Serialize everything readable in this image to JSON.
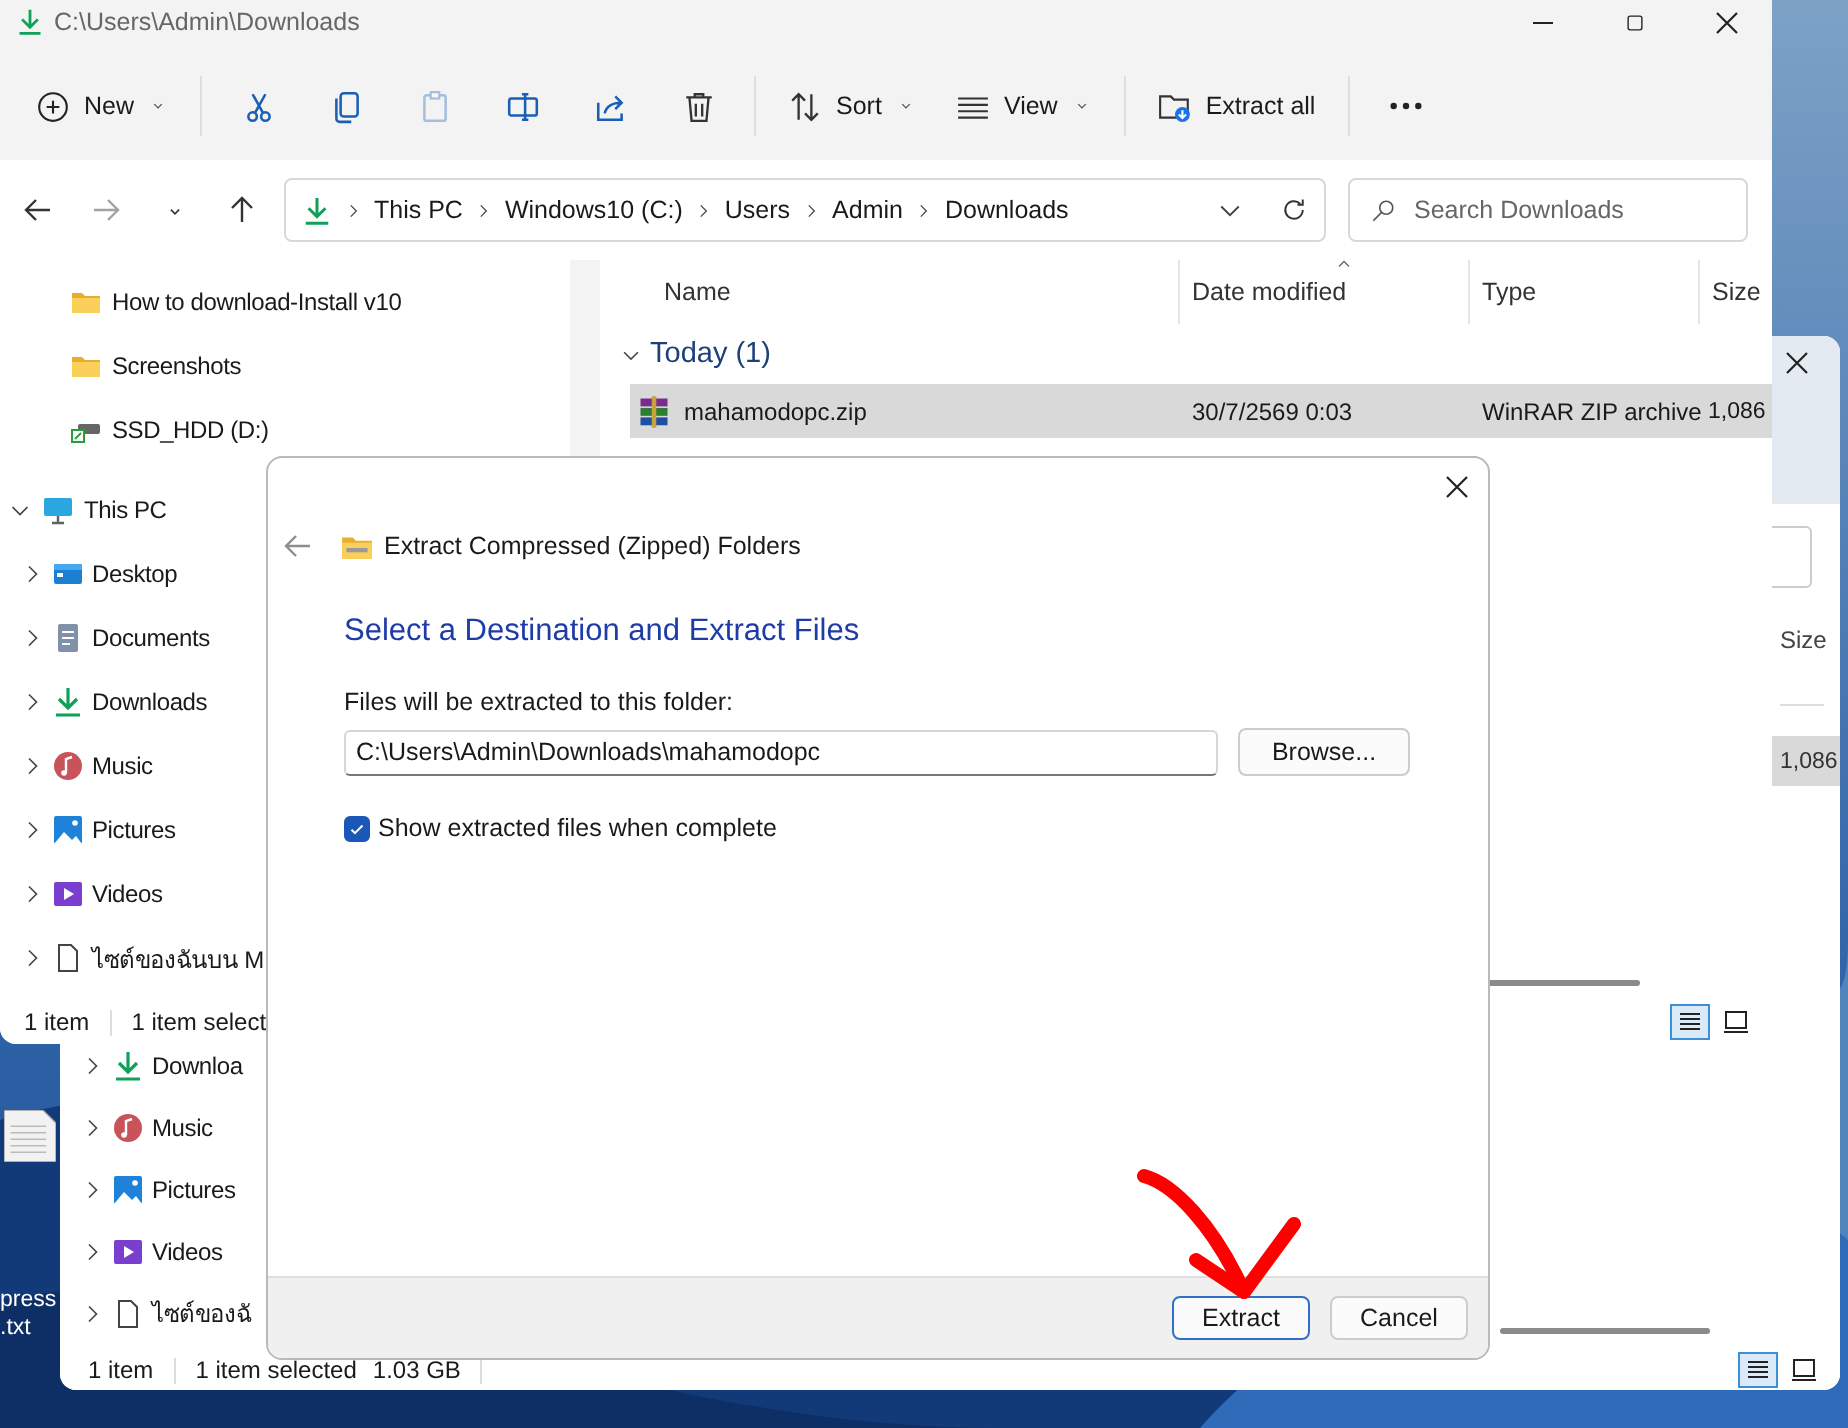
{
  "desktop_icon": {
    "label": "press .txt"
  },
  "back_window": {
    "column": {
      "label": "Size"
    },
    "row": {
      "size": "1,086",
      "selected": true
    },
    "nav_items": [
      {
        "label": "Downloa",
        "kind": "downloads",
        "expanded": false
      },
      {
        "label": "Music",
        "kind": "music",
        "expanded": false
      },
      {
        "label": "Pictures",
        "kind": "pictures",
        "expanded": false
      },
      {
        "label": "Videos",
        "kind": "videos",
        "expanded": false
      },
      {
        "label": "ไซต์ของฉั",
        "kind": "file",
        "expanded": false
      }
    ],
    "status": {
      "count": "1 item",
      "selection": "1 item selected",
      "size": "1.03 GB"
    },
    "view": [
      {
        "kind": "details",
        "selected": true
      },
      {
        "kind": "tiles",
        "selected": false
      }
    ]
  },
  "front_window": {
    "title": "C:\\Users\\Admin\\Downloads",
    "toolbar": [
      {
        "kind": "new",
        "label": "New",
        "disabled": false
      },
      {
        "kind": "separator"
      },
      {
        "kind": "cut",
        "disabled": false
      },
      {
        "kind": "copy",
        "disabled": false
      },
      {
        "kind": "paste",
        "disabled": true
      },
      {
        "kind": "rename",
        "disabled": false
      },
      {
        "kind": "share",
        "disabled": false
      },
      {
        "kind": "delete",
        "disabled": false
      },
      {
        "kind": "separator"
      },
      {
        "kind": "sort",
        "label": "Sort",
        "disabled": false
      },
      {
        "kind": "view",
        "label": "View",
        "disabled": false
      },
      {
        "kind": "separator"
      },
      {
        "kind": "extract",
        "label": "Extract all",
        "disabled": false
      },
      {
        "kind": "separator"
      },
      {
        "kind": "more",
        "disabled": false
      }
    ],
    "nav_buttons": [
      {
        "kind": "back",
        "disabled": false
      },
      {
        "kind": "forward",
        "disabled": true
      },
      {
        "kind": "recent",
        "disabled": false
      },
      {
        "kind": "up",
        "disabled": false
      }
    ],
    "address": {
      "crumbs": [
        "This PC",
        "Windows10 (C:)",
        "Users",
        "Admin",
        "Downloads"
      ]
    },
    "search": {
      "placeholder": "Search Downloads"
    },
    "nav_items": [
      {
        "label": "How to download-Install v10",
        "kind": "folder"
      },
      {
        "label": "Screenshots",
        "kind": "folder"
      },
      {
        "label": "SSD_HDD (D:)",
        "kind": "drive"
      },
      {
        "label": "This PC",
        "kind": "pc",
        "expanded": true,
        "children": [
          {
            "label": "Desktop",
            "kind": "desktop",
            "expanded": false
          },
          {
            "label": "Documents",
            "kind": "documents",
            "expanded": false
          },
          {
            "label": "Downloads",
            "kind": "downloads",
            "expanded": false
          },
          {
            "label": "Music",
            "kind": "music",
            "expanded": false
          },
          {
            "label": "Pictures",
            "kind": "pictures",
            "expanded": false
          },
          {
            "label": "Videos",
            "kind": "videos",
            "expanded": false
          },
          {
            "label": "ไซต์ของฉันบน M",
            "kind": "file",
            "expanded": false
          }
        ]
      }
    ],
    "columns": [
      {
        "label": "Name",
        "sorted": false
      },
      {
        "label": "Date modified",
        "sorted": true
      },
      {
        "label": "Type",
        "sorted": false
      },
      {
        "label": "Size",
        "sorted": false
      }
    ],
    "groups": [
      {
        "label": "Today (1)",
        "expanded": true,
        "rows": [
          {
            "name": "mahamodopc.zip",
            "date": "30/7/2569 0:03",
            "type": "WinRAR ZIP archive",
            "size": "1,086",
            "selected": true
          }
        ]
      }
    ],
    "status": {
      "count": "1 item",
      "selection": "1 item select"
    },
    "view": [
      {
        "kind": "details",
        "selected": true
      },
      {
        "kind": "tiles",
        "selected": false
      }
    ]
  },
  "dialog": {
    "title": "Extract Compressed (Zipped) Folders",
    "heading": "Select a Destination and Extract Files",
    "field_label": "Files will be extracted to this folder:",
    "destination": "C:\\Users\\Admin\\Downloads\\mahamodopc",
    "browse": "Browse...",
    "show_files": {
      "label": "Show extracted files when complete",
      "checked": true
    },
    "buttons": [
      {
        "label": "Extract",
        "default": true
      },
      {
        "label": "Cancel",
        "default": false
      }
    ]
  }
}
